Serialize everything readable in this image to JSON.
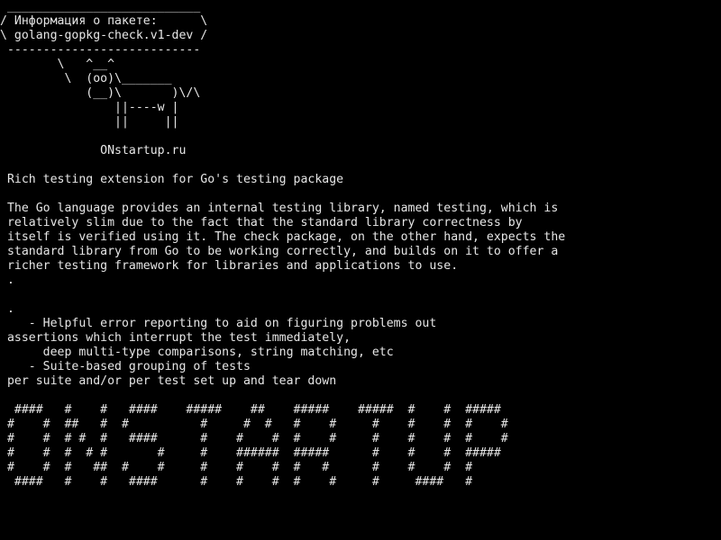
{
  "terminal": {
    "text_color": "#e6e6e6",
    "background_color": "#000000",
    "lines": [
      " ___________________________",
      "/ Информация о пакете:      \\",
      "\\ golang-gopkg-check.v1-dev /",
      " ---------------------------",
      "        \\   ^__^",
      "         \\  (oo)\\_______",
      "            (__)\\       )\\/\\",
      "                ||----w |",
      "                ||     ||",
      "",
      "              ONstartup.ru",
      "",
      " Rich testing extension for Go's testing package",
      "",
      " The Go language provides an internal testing library, named testing, which is",
      " relatively slim due to the fact that the standard library correctness by",
      " itself is verified using it. The check package, on the other hand, expects the",
      " standard library from Go to be working correctly, and builds on it to offer a",
      " richer testing framework for libraries and applications to use.",
      " .",
      "",
      " .",
      "    - Helpful error reporting to aid on figuring problems out",
      " assertions which interrupt the test immediately,",
      "      deep multi-type comparisons, string matching, etc",
      "    - Suite-based grouping of tests",
      " per suite and/or per test set up and tear down",
      "",
      "  ####   #    #   ####    #####    ##    #####    #####  #    #  #####",
      " #    #  ##   #  #          #     #  #   #    #     #    #    #  #    #",
      " #    #  # #  #   ####      #    #    #  #    #     #    #    #  #    #",
      " #    #  #  # #       #     #    ######  #####      #    #    #  #####",
      " #    #  #   ##  #    #     #    #    #  #   #      #    #    #  #",
      "  ####   #    #   ####      #    #    #  #    #     #     ####   #"
    ]
  }
}
